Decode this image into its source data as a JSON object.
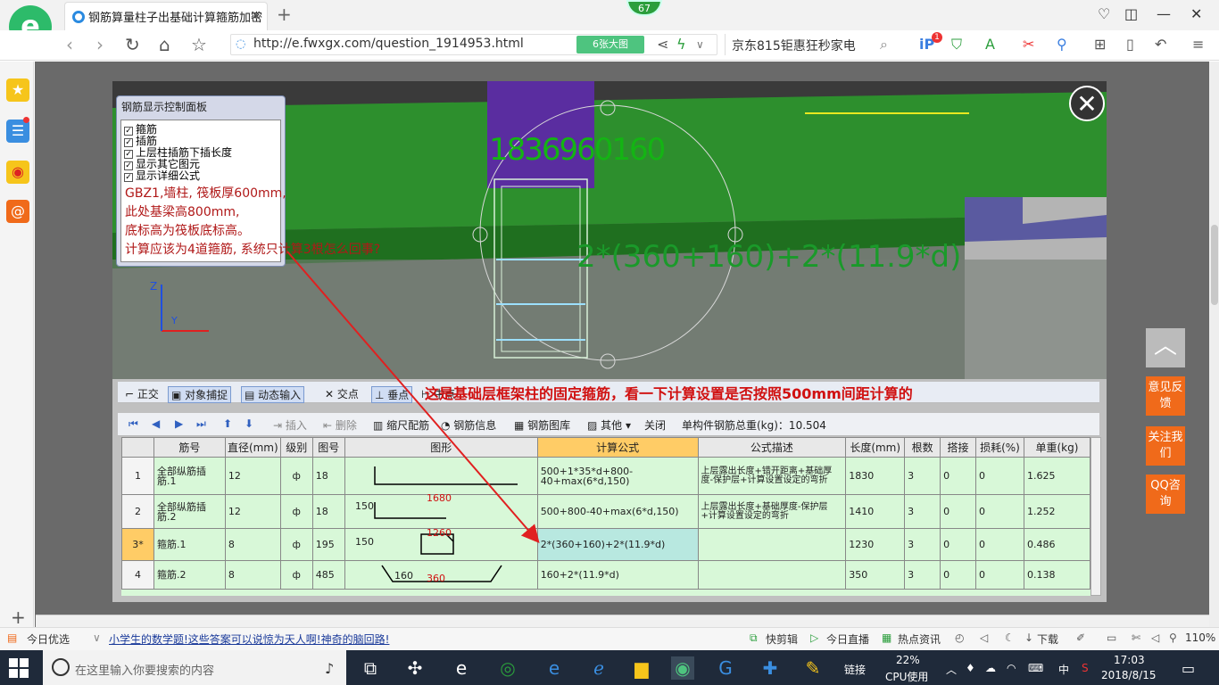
{
  "browser": {
    "tab_title": "钢筋算量柱子出基础计算箍筋加密",
    "tab_close": "✕",
    "badge": "67",
    "url": "http://e.fwxgx.com/question_1914953.html",
    "big_image_btn": "6张大图",
    "search_text": "京东815钜惠狂秒家电",
    "notif_count": "1"
  },
  "viewer": {
    "control_panel": {
      "title": "钢筋显示控制面板",
      "checkboxes": [
        "箍筋",
        "插筋",
        "上层柱插筋下插长度",
        "显示其它图元",
        "显示详细公式"
      ],
      "question_lines": [
        "GBZ1,墙柱, 筏板厚600mm,",
        "此处基梁高800mm,",
        "底标高为筏板底标高。",
        "计算应该为4道箍筋, 系统只计算3根怎么回事?"
      ]
    },
    "big_label": "1836960160",
    "big_formula": "2*(360+160)+2*(11.9*d)",
    "red_annotation": "这是基础层框架柱的固定箍筋，看一下计算设置是否按照500mm间距计算的",
    "toolbar1": [
      "正交",
      "对象捕捉",
      "动态输入",
      "交点",
      "垂点",
      "中点"
    ],
    "toolbar2": {
      "insert": "插入",
      "delete": "删除",
      "scale": "缩尺配筋",
      "info": "钢筋信息",
      "library": "钢筋图库",
      "other": "其他",
      "close": "关闭",
      "total": "单构件钢筋总重(kg)：10.504"
    },
    "table": {
      "headers": [
        "",
        "筋号",
        "直径(mm)",
        "级别",
        "图号",
        "图形",
        "计算公式",
        "公式描述",
        "长度(mm)",
        "根数",
        "搭接",
        "损耗(%)",
        "单重(kg)"
      ],
      "rows": [
        {
          "n": "1",
          "name": "全部纵筋插筋.1",
          "dia": "12",
          "grade": "ф",
          "fig": "18",
          "shape_l": "150",
          "shape_v": "1680",
          "formula": "500+1*35*d+800-40+max(6*d,150)",
          "desc": "上层露出长度+错开距离+基础厚度-保护层+计算设置设定的弯折",
          "len": "1830",
          "cnt": "3",
          "lap": "0",
          "loss": "0",
          "wt": "1.625"
        },
        {
          "n": "2",
          "name": "全部纵筋插筋.2",
          "dia": "12",
          "grade": "ф",
          "fig": "18",
          "shape_l": "150",
          "shape_v": "1260",
          "formula": "500+800-40+max(6*d,150)",
          "desc": "上层露出长度+基础厚度-保护层+计算设置设定的弯折",
          "len": "1410",
          "cnt": "3",
          "lap": "0",
          "loss": "0",
          "wt": "1.252"
        },
        {
          "n": "3*",
          "name": "箍筋.1",
          "dia": "8",
          "grade": "ф",
          "fig": "195",
          "shape_l": "160",
          "shape_v": "360",
          "formula": "2*(360+160)+2*(11.9*d)",
          "desc": "",
          "len": "1230",
          "cnt": "3",
          "lap": "0",
          "loss": "0",
          "wt": "0.486"
        },
        {
          "n": "4",
          "name": "箍筋.2",
          "dia": "8",
          "grade": "ф",
          "fig": "485",
          "shape_l": "",
          "shape_v": "160",
          "formula": "160+2*(11.9*d)",
          "desc": "",
          "len": "350",
          "cnt": "3",
          "lap": "0",
          "loss": "0",
          "wt": "0.138"
        }
      ]
    }
  },
  "right_float": [
    "意见反馈",
    "关注我们",
    "QQ咨询"
  ],
  "bottombar": {
    "left": "今日优选",
    "news": "小学生的数学题!这些答案可以说惊为天人啊!神奇的脑回路!",
    "items": [
      "快剪辑",
      "今日直播",
      "热点资讯",
      "下载"
    ],
    "zoom": "110%"
  },
  "taskbar": {
    "search_placeholder": "在这里输入你要搜索的内容",
    "link": "链接",
    "cpu_pct": "22%",
    "cpu_label": "CPU使用",
    "ime": "中",
    "time": "17:03",
    "date": "2018/8/15"
  }
}
